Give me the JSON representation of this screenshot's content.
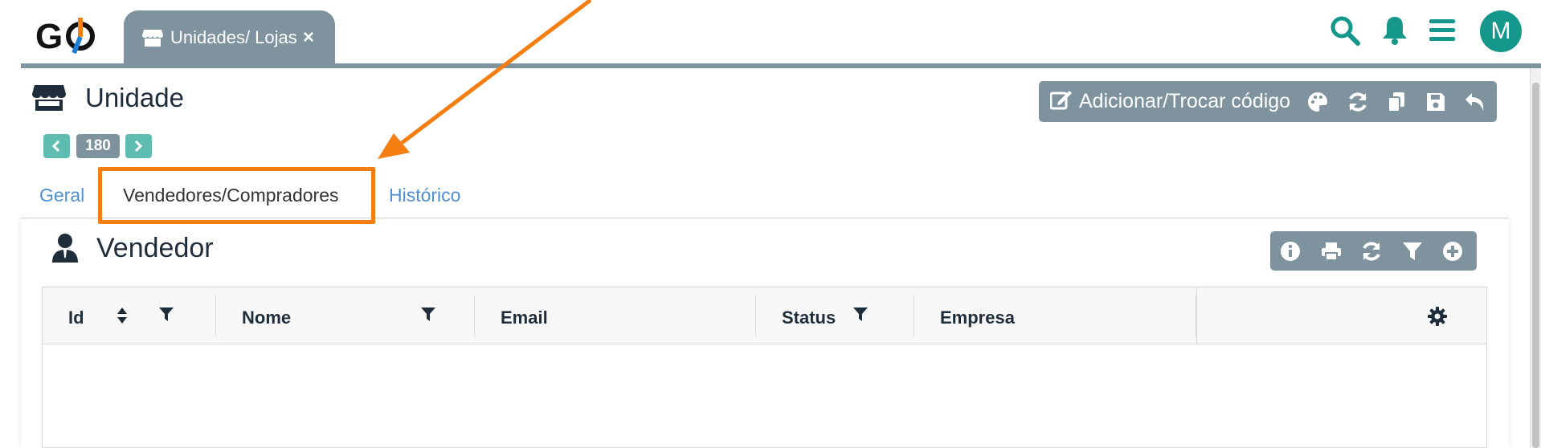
{
  "app": {
    "logo_text": "GO",
    "brand_color": "#16978b",
    "tab": {
      "title": "Unidades/ Lojas",
      "close": "×",
      "icon": "store-icon"
    },
    "header_icons": [
      "search-icon",
      "bell-icon",
      "menu-icon"
    ],
    "avatar_initial": "M"
  },
  "page": {
    "title": "Unidade",
    "record_id": "180",
    "prev_label": "‹",
    "next_label": "›",
    "toolbar": {
      "change_code_label": "Adicionar/Trocar código",
      "icons": [
        "edit-icon",
        "palette-icon",
        "refresh-icon",
        "copy-icon",
        "save-icon",
        "undo-icon"
      ]
    },
    "tabs": [
      {
        "label": "Geral",
        "active": false
      },
      {
        "label": "Vendedores/Compradores",
        "active": true
      },
      {
        "label": "Histórico",
        "active": false
      }
    ],
    "highlight_color": "#f57e13"
  },
  "section": {
    "title": "Vendedor",
    "tools": [
      "info-icon",
      "print-icon",
      "refresh-icon",
      "filter-icon",
      "add-icon"
    ],
    "columns": [
      {
        "label": "Id",
        "sortable": true,
        "filter": true
      },
      {
        "label": "Nome",
        "sortable": false,
        "filter": true
      },
      {
        "label": "Email",
        "sortable": false,
        "filter": false
      },
      {
        "label": "Status",
        "sortable": false,
        "filter": true
      },
      {
        "label": "Empresa",
        "sortable": false,
        "filter": false
      }
    ],
    "settings_icon": "gear-icon",
    "rows": []
  }
}
